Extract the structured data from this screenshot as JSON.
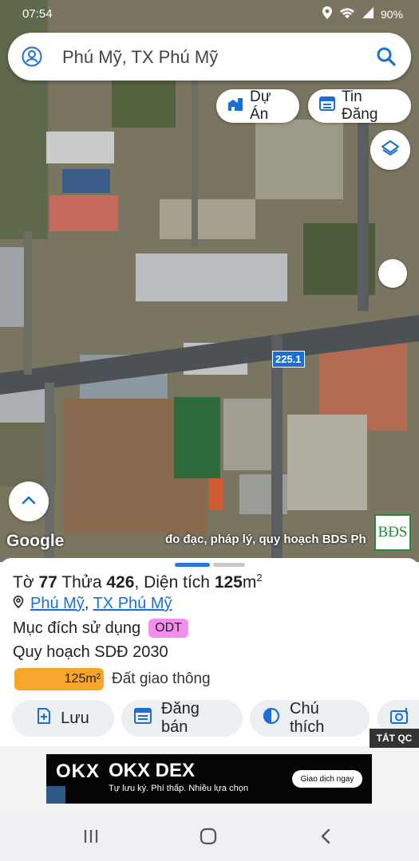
{
  "status_bar": {
    "time": "07:54",
    "battery": "90%"
  },
  "search": {
    "value": "Phú Mỹ, TX Phú Mỹ",
    "placeholder": "Phú Mỹ, TX Phú Mỹ ..."
  },
  "chips": {
    "du_an": "Dự Án",
    "tin_dang": "Tin Đăng"
  },
  "map": {
    "road_label": "225.1",
    "google_logo": "Google",
    "attribution": "đo đạc, pháp lý, quy hoạch BDS Ph",
    "brand_logo": "BĐS"
  },
  "parcel": {
    "to_label": "Tờ",
    "to_value": "77",
    "thua_label": "Thửa",
    "thua_value": "426",
    "dientich_label": "Diện tích",
    "dientich_value": "125",
    "unit": "m",
    "unit_sup": "2",
    "location_1": "Phú Mỹ",
    "location_2": "TX Phú Mỹ",
    "purpose_label": "Mục đích sử dụng",
    "purpose_code": "ODT",
    "plan_label": "Quy hoạch SDĐ 2030",
    "plan_area": "125m²",
    "plan_type": "Đất giao thông",
    "plan_color": "#f7a52b",
    "odt_color": "#f48ff0"
  },
  "actions": {
    "save": "Lưu",
    "post": "Đăng bán",
    "legend": "Chú thích"
  },
  "ad": {
    "close_label": "TẮT QC",
    "brand": "OKX",
    "title": "OKX DEX",
    "subtitle": "Tự lưu ký. Phí thấp. Nhiều lựa chọn",
    "cta": "Giao dịch ngay"
  }
}
